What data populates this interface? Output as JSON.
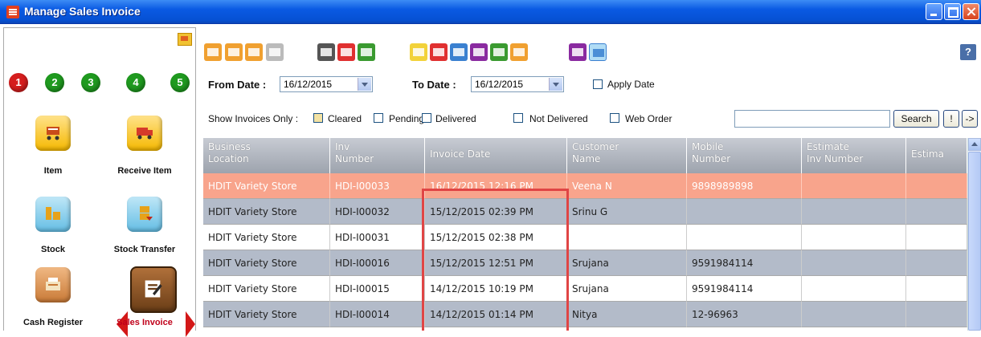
{
  "window": {
    "title": "Manage Sales Invoice"
  },
  "sidebar": {
    "steps": [
      "1",
      "2",
      "3",
      "4",
      "5"
    ],
    "nav": [
      {
        "label": "Item",
        "icon": "cart-icon"
      },
      {
        "label": "Receive Item",
        "icon": "truck-icon"
      },
      {
        "label": "Stock",
        "icon": "stock-icon"
      },
      {
        "label": "Stock Transfer",
        "icon": "stock-transfer-icon"
      },
      {
        "label": "Cash Register",
        "icon": "cash-register-icon"
      },
      {
        "label": "Sales Invoice",
        "icon": "sales-invoice-icon",
        "active": true
      }
    ]
  },
  "filters": {
    "from_label": "From Date :",
    "from_value": "16/12/2015",
    "to_label": "To Date :",
    "to_value": "16/12/2015",
    "apply_date": "Apply Date",
    "show_only_label": "Show Invoices Only :",
    "cleared": "Cleared",
    "pending": "Pending",
    "delivered": "Delivered",
    "not_delivered": "Not Delivered",
    "web_order": "Web Order",
    "search_button": "Search",
    "btn_excl": "!",
    "btn_arrow": "->"
  },
  "table": {
    "columns": [
      [
        "Business",
        "Location"
      ],
      [
        "Inv",
        "Number"
      ],
      [
        "Invoice Date",
        ""
      ],
      [
        "Customer",
        "Name"
      ],
      [
        "Mobile",
        "Number"
      ],
      [
        "Estimate",
        "Inv Number"
      ],
      [
        "Estima",
        ""
      ]
    ],
    "rows": [
      [
        "HDIT Variety Store",
        "HDI-I00033",
        "16/12/2015 12:16 PM",
        "Veena N",
        "9898989898",
        "",
        ""
      ],
      [
        "HDIT Variety Store",
        "HDI-I00032",
        "15/12/2015 02:39 PM",
        "Srinu G",
        "",
        "",
        ""
      ],
      [
        "HDIT Variety Store",
        "HDI-I00031",
        "15/12/2015 02:38 PM",
        "",
        "",
        "",
        ""
      ],
      [
        "HDIT Variety Store",
        "HDI-I00016",
        "15/12/2015 12:51 PM",
        "Srujana",
        "9591984114",
        "",
        ""
      ],
      [
        "HDIT Variety Store",
        "HDI-I00015",
        "14/12/2015 10:19 PM",
        "Srujana",
        "9591984114",
        "",
        ""
      ],
      [
        "HDIT Variety Store",
        "HDI-I00014",
        "14/12/2015 01:14 PM",
        "Nitya",
        "12-96963",
        "",
        ""
      ]
    ]
  },
  "colors": {
    "title_bar": "#0a5ae3",
    "selected_row": "#f8a48c",
    "alt_row": "#b3bbc9",
    "highlight": "#e04545"
  }
}
